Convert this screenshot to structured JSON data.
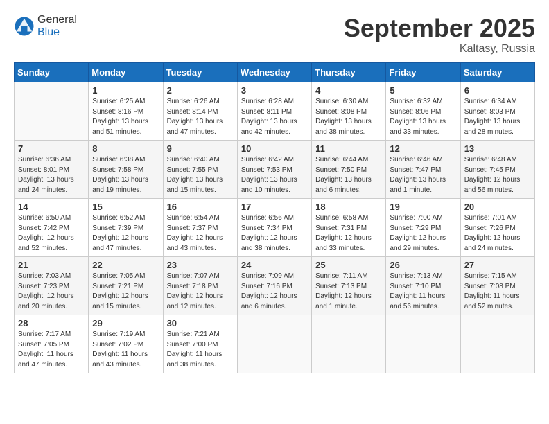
{
  "header": {
    "logo_general": "General",
    "logo_blue": "Blue",
    "month": "September 2025",
    "location": "Kaltasy, Russia"
  },
  "days_of_week": [
    "Sunday",
    "Monday",
    "Tuesday",
    "Wednesday",
    "Thursday",
    "Friday",
    "Saturday"
  ],
  "weeks": [
    [
      {
        "day": "",
        "detail": ""
      },
      {
        "day": "1",
        "detail": "Sunrise: 6:25 AM\nSunset: 8:16 PM\nDaylight: 13 hours\nand 51 minutes."
      },
      {
        "day": "2",
        "detail": "Sunrise: 6:26 AM\nSunset: 8:14 PM\nDaylight: 13 hours\nand 47 minutes."
      },
      {
        "day": "3",
        "detail": "Sunrise: 6:28 AM\nSunset: 8:11 PM\nDaylight: 13 hours\nand 42 minutes."
      },
      {
        "day": "4",
        "detail": "Sunrise: 6:30 AM\nSunset: 8:08 PM\nDaylight: 13 hours\nand 38 minutes."
      },
      {
        "day": "5",
        "detail": "Sunrise: 6:32 AM\nSunset: 8:06 PM\nDaylight: 13 hours\nand 33 minutes."
      },
      {
        "day": "6",
        "detail": "Sunrise: 6:34 AM\nSunset: 8:03 PM\nDaylight: 13 hours\nand 28 minutes."
      }
    ],
    [
      {
        "day": "7",
        "detail": "Sunrise: 6:36 AM\nSunset: 8:01 PM\nDaylight: 13 hours\nand 24 minutes."
      },
      {
        "day": "8",
        "detail": "Sunrise: 6:38 AM\nSunset: 7:58 PM\nDaylight: 13 hours\nand 19 minutes."
      },
      {
        "day": "9",
        "detail": "Sunrise: 6:40 AM\nSunset: 7:55 PM\nDaylight: 13 hours\nand 15 minutes."
      },
      {
        "day": "10",
        "detail": "Sunrise: 6:42 AM\nSunset: 7:53 PM\nDaylight: 13 hours\nand 10 minutes."
      },
      {
        "day": "11",
        "detail": "Sunrise: 6:44 AM\nSunset: 7:50 PM\nDaylight: 13 hours\nand 6 minutes."
      },
      {
        "day": "12",
        "detail": "Sunrise: 6:46 AM\nSunset: 7:47 PM\nDaylight: 13 hours\nand 1 minute."
      },
      {
        "day": "13",
        "detail": "Sunrise: 6:48 AM\nSunset: 7:45 PM\nDaylight: 12 hours\nand 56 minutes."
      }
    ],
    [
      {
        "day": "14",
        "detail": "Sunrise: 6:50 AM\nSunset: 7:42 PM\nDaylight: 12 hours\nand 52 minutes."
      },
      {
        "day": "15",
        "detail": "Sunrise: 6:52 AM\nSunset: 7:39 PM\nDaylight: 12 hours\nand 47 minutes."
      },
      {
        "day": "16",
        "detail": "Sunrise: 6:54 AM\nSunset: 7:37 PM\nDaylight: 12 hours\nand 43 minutes."
      },
      {
        "day": "17",
        "detail": "Sunrise: 6:56 AM\nSunset: 7:34 PM\nDaylight: 12 hours\nand 38 minutes."
      },
      {
        "day": "18",
        "detail": "Sunrise: 6:58 AM\nSunset: 7:31 PM\nDaylight: 12 hours\nand 33 minutes."
      },
      {
        "day": "19",
        "detail": "Sunrise: 7:00 AM\nSunset: 7:29 PM\nDaylight: 12 hours\nand 29 minutes."
      },
      {
        "day": "20",
        "detail": "Sunrise: 7:01 AM\nSunset: 7:26 PM\nDaylight: 12 hours\nand 24 minutes."
      }
    ],
    [
      {
        "day": "21",
        "detail": "Sunrise: 7:03 AM\nSunset: 7:23 PM\nDaylight: 12 hours\nand 20 minutes."
      },
      {
        "day": "22",
        "detail": "Sunrise: 7:05 AM\nSunset: 7:21 PM\nDaylight: 12 hours\nand 15 minutes."
      },
      {
        "day": "23",
        "detail": "Sunrise: 7:07 AM\nSunset: 7:18 PM\nDaylight: 12 hours\nand 12 minutes."
      },
      {
        "day": "24",
        "detail": "Sunrise: 7:09 AM\nSunset: 7:16 PM\nDaylight: 12 hours\nand 6 minutes."
      },
      {
        "day": "25",
        "detail": "Sunrise: 7:11 AM\nSunset: 7:13 PM\nDaylight: 12 hours\nand 1 minute."
      },
      {
        "day": "26",
        "detail": "Sunrise: 7:13 AM\nSunset: 7:10 PM\nDaylight: 11 hours\nand 56 minutes."
      },
      {
        "day": "27",
        "detail": "Sunrise: 7:15 AM\nSunset: 7:08 PM\nDaylight: 11 hours\nand 52 minutes."
      }
    ],
    [
      {
        "day": "28",
        "detail": "Sunrise: 7:17 AM\nSunset: 7:05 PM\nDaylight: 11 hours\nand 47 minutes."
      },
      {
        "day": "29",
        "detail": "Sunrise: 7:19 AM\nSunset: 7:02 PM\nDaylight: 11 hours\nand 43 minutes."
      },
      {
        "day": "30",
        "detail": "Sunrise: 7:21 AM\nSunset: 7:00 PM\nDaylight: 11 hours\nand 38 minutes."
      },
      {
        "day": "",
        "detail": ""
      },
      {
        "day": "",
        "detail": ""
      },
      {
        "day": "",
        "detail": ""
      },
      {
        "day": "",
        "detail": ""
      }
    ]
  ]
}
